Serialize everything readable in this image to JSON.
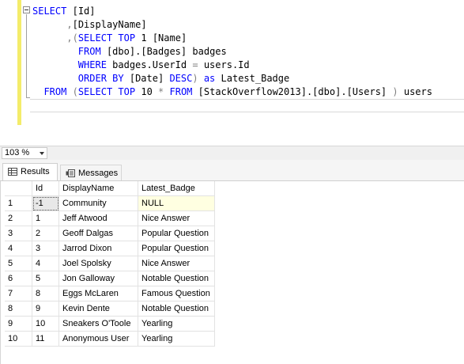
{
  "editor": {
    "lines": [
      {
        "parts": [
          [
            "kw",
            "SELECT"
          ],
          [
            "",
            "["
          ],
          [
            "",
            "Id"
          ],
          [
            "gray",
            "]"
          ]
        ]
      },
      {
        "parts": [
          [
            "gray",
            "      ,"
          ],
          [
            "",
            "[DisplayName]"
          ]
        ]
      },
      {
        "parts": [
          [
            "gray",
            "      ,("
          ],
          [
            "kw",
            "SELECT TOP"
          ],
          [
            "",
            "1 "
          ],
          [
            "",
            "[Name]"
          ]
        ]
      }
    ],
    "code": [
      "SELECT [Id]",
      "      ,[DisplayName]",
      "      ,(SELECT TOP 1 [Name]",
      "        FROM [dbo].[Badges] badges",
      "        WHERE badges.UserId = users.Id",
      "        ORDER BY [Date] DESC) as Latest_Badge",
      "  FROM (SELECT TOP 10 * FROM [StackOverflow2013].[dbo].[Users] ) users"
    ]
  },
  "zoom": "103 %",
  "tabs": {
    "results": "Results",
    "messages": "Messages"
  },
  "grid": {
    "columns": [
      "Id",
      "DisplayName",
      "Latest_Badge"
    ],
    "rows": [
      {
        "n": "1",
        "id": "-1",
        "name": "Community",
        "badge": "NULL"
      },
      {
        "n": "2",
        "id": "1",
        "name": "Jeff Atwood",
        "badge": "Nice Answer"
      },
      {
        "n": "3",
        "id": "2",
        "name": "Geoff Dalgas",
        "badge": "Popular Question"
      },
      {
        "n": "4",
        "id": "3",
        "name": "Jarrod Dixon",
        "badge": "Popular Question"
      },
      {
        "n": "5",
        "id": "4",
        "name": "Joel Spolsky",
        "badge": "Nice Answer"
      },
      {
        "n": "6",
        "id": "5",
        "name": "Jon Galloway",
        "badge": "Notable Question"
      },
      {
        "n": "7",
        "id": "8",
        "name": "Eggs McLaren",
        "badge": "Famous Question"
      },
      {
        "n": "8",
        "id": "9",
        "name": "Kevin Dente",
        "badge": "Notable Question"
      },
      {
        "n": "9",
        "id": "10",
        "name": "Sneakers O'Toole",
        "badge": "Yearling"
      },
      {
        "n": "10",
        "id": "11",
        "name": "Anonymous User",
        "badge": "Yearling"
      }
    ]
  },
  "colors": {
    "keyword": "#0000ff",
    "operator": "#808080",
    "function": "#ff00ff",
    "change_bar": "#f4ec6a",
    "selected_cell": "#ffffe1"
  },
  "icons": {
    "collapse": "collapse-minus-icon",
    "results": "grid-icon",
    "messages": "messages-icon",
    "zoom": "chevron-down-icon"
  }
}
